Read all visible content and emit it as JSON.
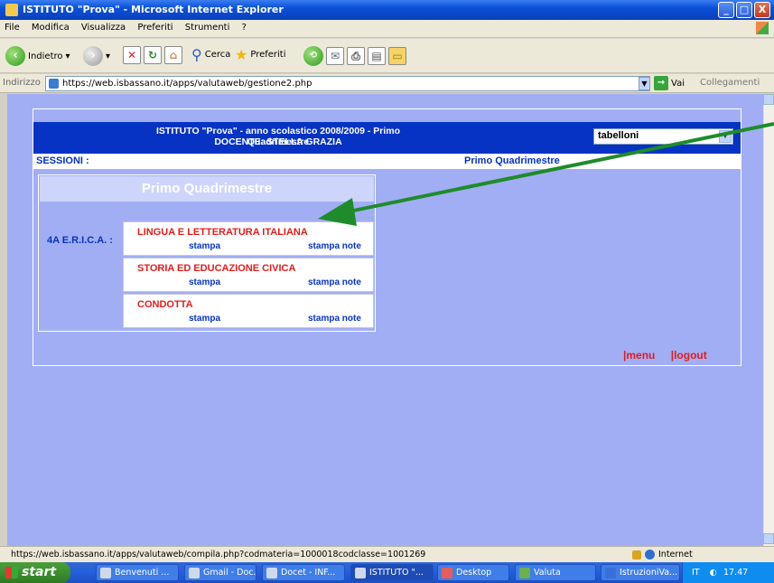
{
  "window": {
    "title": "ISTITUTO \"Prova\" - Microsoft Internet Explorer",
    "buttons": {
      "min": "_",
      "max": "□",
      "close": "X"
    }
  },
  "menubar": [
    "File",
    "Modifica",
    "Visualizza",
    "Preferiti",
    "Strumenti",
    "?"
  ],
  "toolbar": {
    "back": "Indietro",
    "search": "Cerca",
    "favorites": "Preferiti"
  },
  "addressbar": {
    "label": "Indirizzo",
    "url": "https://web.isbassano.it/apps/valutaweb/gestione2.php",
    "go": "Vai",
    "links": "Collegamenti"
  },
  "page": {
    "header_line1": "ISTITUTO \"Prova\" - anno scolastico 2008/2009 - Primo Quadrimestre",
    "header_line2": "DOCENTE: STELLA GRAZIA",
    "select_value": "tabelloni",
    "sessions_label": "SESSIONI :",
    "sessions_value": "Primo Quadrimestre",
    "panel_title": "Primo Quadrimestre",
    "class_label": "4A E.R.I.C.A. :",
    "subjects": [
      {
        "name": "LINGUA E LETTERATURA ITALIANA",
        "stampa": "stampa",
        "note": "stampa note"
      },
      {
        "name": "STORIA ED EDUCAZIONE CIVICA",
        "stampa": "stampa",
        "note": "stampa note"
      },
      {
        "name": "CONDOTTA",
        "stampa": "stampa",
        "note": "stampa note"
      }
    ],
    "menu_link": "|menu",
    "logout_link": "|logout"
  },
  "statusbar": {
    "url": "https://web.isbassano.it/apps/valutaweb/compila.php?codmateria=1000018codclasse=1001269",
    "zone": "Internet"
  },
  "taskbar": {
    "start": "start",
    "tasks": [
      "Benvenuti ...",
      "Gmail - Doc...",
      "Docet - INF...",
      "ISTITUTO \"...",
      "Desktop",
      "Valuta",
      "IstruzioniVa..."
    ],
    "lang": "IT",
    "clock": "17.47"
  },
  "colors": {
    "page_bg": "#a2aef4",
    "header_blue": "#0633c4",
    "subject_red": "#e21c1c",
    "arrow_green": "#1e8c2a"
  }
}
